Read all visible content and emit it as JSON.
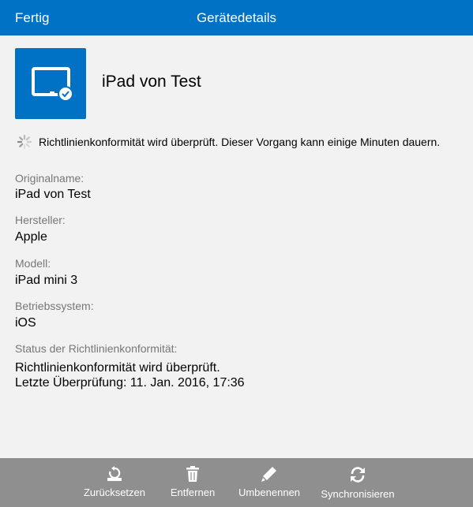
{
  "header": {
    "done_label": "Fertig",
    "title": "Gerätedetails",
    "background": "#0072c6"
  },
  "device": {
    "name": "iPad von Test",
    "tile_color": "#0072c6",
    "icon": "tablet-check-icon"
  },
  "sync_status": {
    "icon": "spinner-icon",
    "text": "Richtlinienkonformität wird überprüft. Dieser Vorgang kann einige Minuten dauern."
  },
  "fields": [
    {
      "label": "Originalname:",
      "value": "iPad von Test"
    },
    {
      "label": "Hersteller:",
      "value": "Apple"
    },
    {
      "label": "Modell:",
      "value": "iPad mini 3"
    },
    {
      "label": "Betriebssystem:",
      "value": "iOS"
    }
  ],
  "compliance": {
    "label": "Status der Richtlinienkonformität:",
    "line1": "Richtlinienkonformität wird überprüft.",
    "line2": "Letzte Überprüfung: 11. Jan. 2016, 17:36"
  },
  "toolbar": {
    "background": "#8f8f8f",
    "reset": {
      "label": "Zurücksetzen",
      "icon": "reset-icon"
    },
    "remove": {
      "label": "Entfernen",
      "icon": "trash-icon"
    },
    "rename": {
      "label": "Umbenennen",
      "icon": "pencil-icon"
    },
    "sync": {
      "label": "Synchronisieren",
      "icon": "sync-icon"
    }
  }
}
